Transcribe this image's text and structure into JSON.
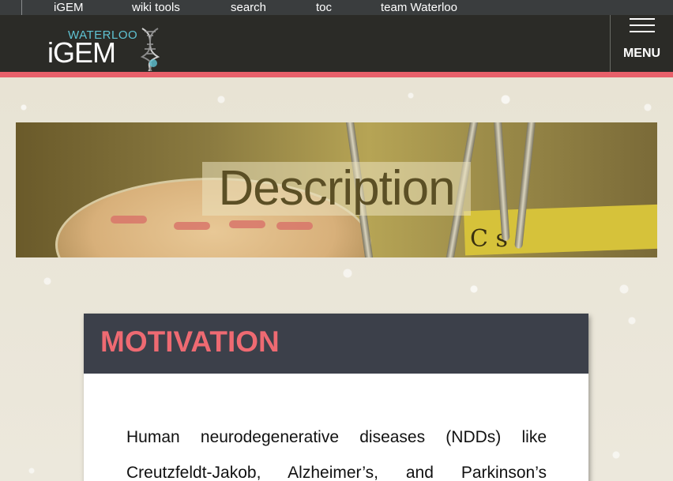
{
  "topbar": {
    "items": [
      "iGEM",
      "wiki tools",
      "search",
      "toc",
      "team Waterloo"
    ]
  },
  "header": {
    "logo_top": "WATERLOO",
    "logo_main": "iGEM",
    "menu_label": "MENU",
    "accent_color": "#e8606a"
  },
  "banner": {
    "title": "Description",
    "handwriting": "C  s"
  },
  "motivation": {
    "heading": "MOTIVATION",
    "heading_color": "#ee6a72",
    "text": "Human neurodegenerative diseases (NDDs) like Creutzfeldt-Jakob, Alzheimer’s, and Parkinson’s"
  }
}
